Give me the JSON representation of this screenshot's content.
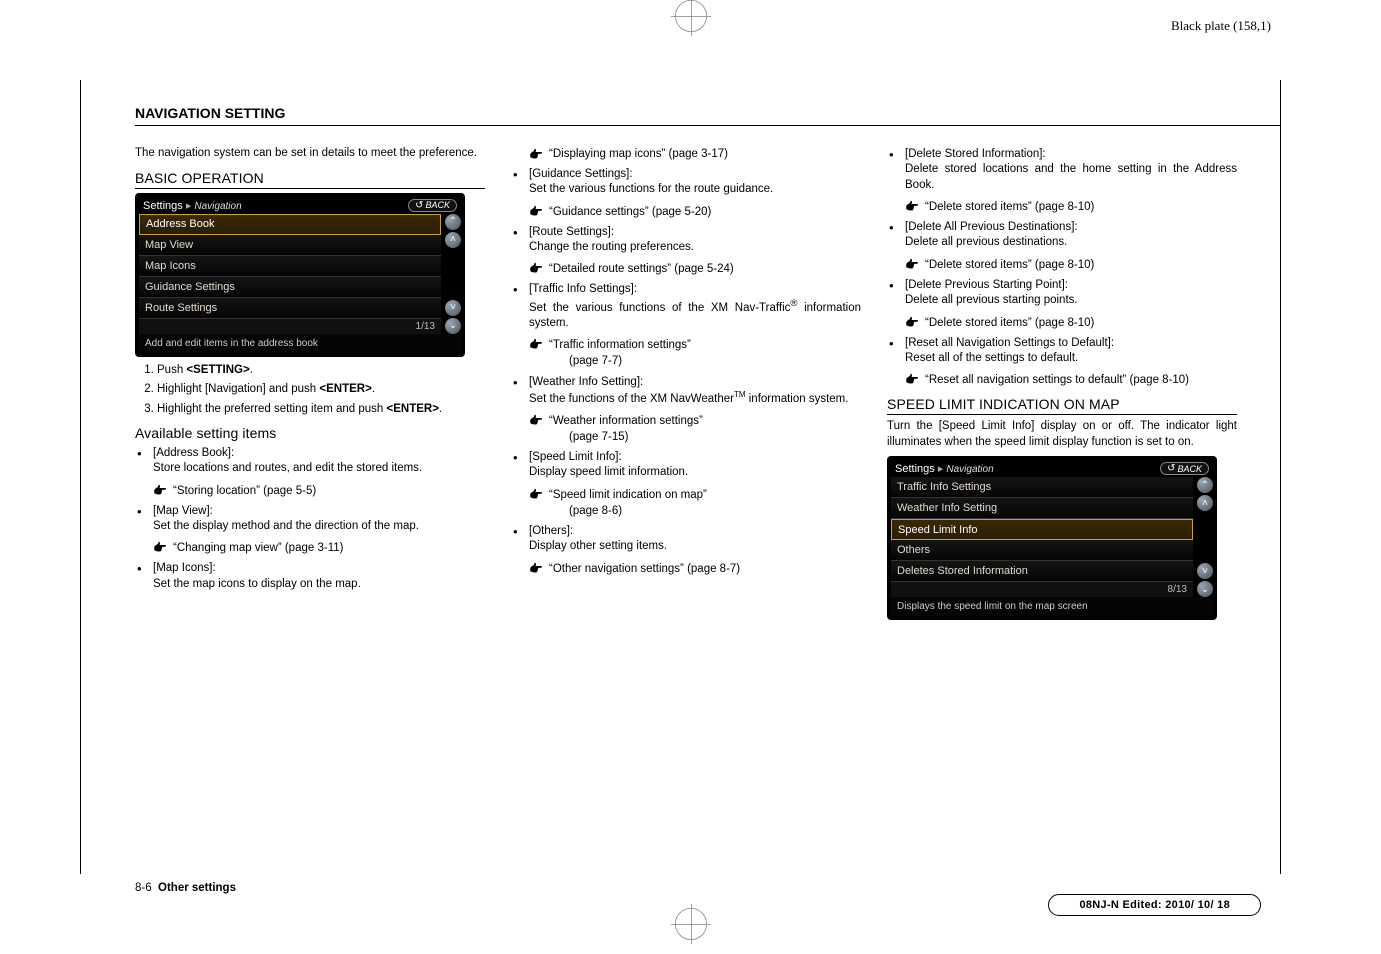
{
  "plate_mark": "Black plate (158,1)",
  "section_title": "NAVIGATION SETTING",
  "intro": "The navigation system can be set in details to meet the preference.",
  "col1": {
    "basic_op": "BASIC OPERATION",
    "scr1": {
      "title": "Settings",
      "sub": "Navigation",
      "back": "BACK",
      "rows": [
        "Address Book",
        "Map View",
        "Map Icons",
        "Guidance Settings",
        "Route Settings"
      ],
      "counter": "1/13",
      "helper": "Add and edit items in the address book"
    },
    "steps": [
      {
        "pre": "Push ",
        "bold": "<SETTING>",
        "post": "."
      },
      {
        "pre": "Highlight [Navigation] and push ",
        "bold": "<ENTER>",
        "post": "."
      },
      {
        "pre": "Highlight the preferred setting item and push ",
        "bold": "<ENTER>",
        "post": "."
      }
    ],
    "avail_head": "Available setting items",
    "avail": [
      {
        "t": "[Address Book]:",
        "d": "Store locations and routes, and edit the stored items.",
        "r": "“Storing location” (page 5-5)"
      },
      {
        "t": "[Map View]:",
        "d": "Set the display method and the direction of the map.",
        "r": "“Changing map view” (page 3-11)"
      },
      {
        "t": "[Map Icons]:",
        "d": "Set the map icons to display on the map."
      }
    ]
  },
  "col2": {
    "topref": "“Displaying map icons” (page 3-17)",
    "items": [
      {
        "t": "[Guidance Settings]:",
        "d": "Set the various functions for the route guidance.",
        "r": "“Guidance settings” (page 5-20)"
      },
      {
        "t": "[Route Settings]:",
        "d": "Change the routing preferences.",
        "r": "“Detailed route settings” (page 5-24)"
      },
      {
        "t": "[Traffic Info Settings]:",
        "d_pre": "Set the various functions of the XM Nav-Traffic",
        "sup": "®",
        "d_post": " information system.",
        "r": "“Traffic information settings”",
        "r2": "(page 7-7)"
      },
      {
        "t": "[Weather Info Setting]:",
        "d_pre": "Set the functions of the XM NavWeather",
        "sup": "TM",
        "d_post": " information system.",
        "r": "“Weather information settings”",
        "r2": "(page 7-15)"
      },
      {
        "t": "[Speed Limit Info]:",
        "d": "Display speed limit information.",
        "r": "“Speed limit indication on map”",
        "r2": "(page 8-6)"
      },
      {
        "t": "[Others]:",
        "d": "Display other setting items.",
        "r": "“Other navigation settings” (page 8-7)"
      }
    ]
  },
  "col3": {
    "items": [
      {
        "t": "[Delete Stored Information]:",
        "d": "Delete stored locations and the home setting in the Address Book.",
        "r": "“Delete stored items” (page 8-10)"
      },
      {
        "t": "[Delete All Previous Destinations]:",
        "d": "Delete all previous destinations.",
        "r": "“Delete stored items” (page 8-10)"
      },
      {
        "t": "[Delete Previous Starting Point]:",
        "d": "Delete all previous starting points.",
        "r": "“Delete stored items” (page 8-10)"
      },
      {
        "t": "[Reset all Navigation Settings to Default]:",
        "d": "Reset all of the settings to default.",
        "r": "“Reset all navigation settings to default” (page 8-10)"
      }
    ],
    "speed_head": "SPEED LIMIT INDICATION ON MAP",
    "speed_p": "Turn the [Speed Limit Info] display on or off. The indicator light illuminates when the speed limit display function is set to on.",
    "scr2": {
      "title": "Settings",
      "sub": "Navigation",
      "back": "BACK",
      "rows": [
        "Traffic Info Settings",
        "Weather Info Setting",
        "Speed Limit Info",
        "Others",
        "Deletes Stored Information"
      ],
      "counter": "8/13",
      "helper": "Displays the speed limit on the map screen"
    }
  },
  "footer_page": "8-6",
  "footer_label": "Other settings",
  "editstamp": "08NJ-N Edited:  2010/ 10/ 18"
}
